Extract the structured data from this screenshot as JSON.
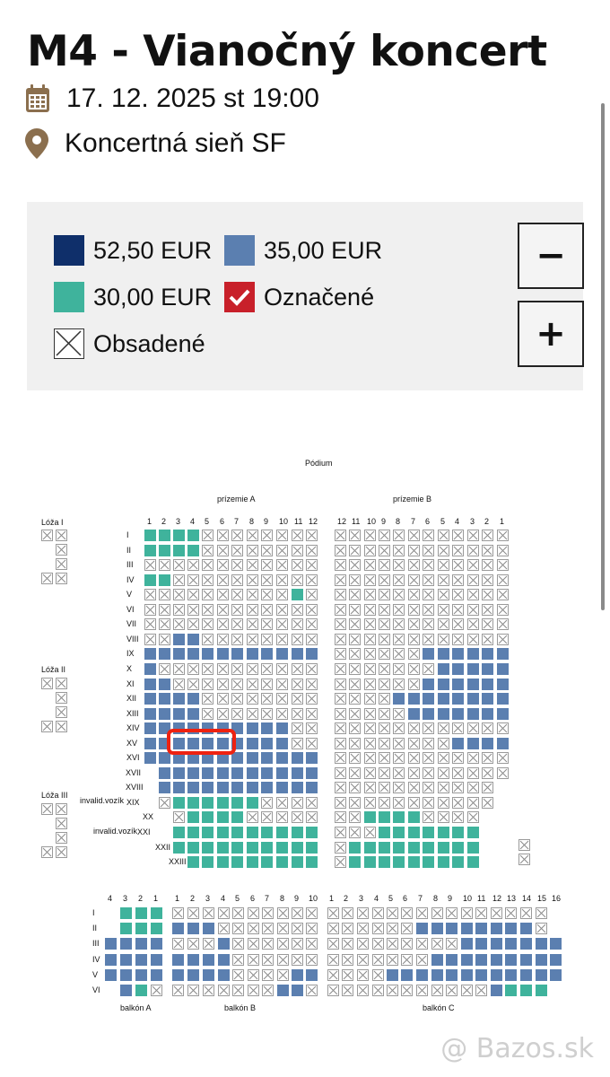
{
  "event": {
    "title": "M4 - Vianočný koncert",
    "datetime": "17. 12. 2025 st 19:00",
    "venue": "Koncertná sieň SF"
  },
  "icons": {
    "date": "calendar-icon",
    "venue": "map-pin-icon",
    "selected": "checkmark-icon",
    "taken": "cross-icon"
  },
  "colors": {
    "accent": "#8b6f4e",
    "price_52": "#0f2f6a",
    "price_35": "#5b7fb0",
    "price_30": "#3fb39c",
    "selected": "#c8202a",
    "highlight": "#ee2211"
  },
  "legend": {
    "items": [
      "52,50 EUR",
      "35,00 EUR",
      "30,00 EUR",
      "Označené",
      "Obsadené"
    ],
    "zoom_out": "−",
    "zoom_in": "+"
  },
  "seatmap": {
    "stage": "Pódium",
    "section_a": "prízemie A",
    "section_b": "prízemie B",
    "loza": [
      "Lóža I",
      "Lóža II",
      "Lóža III"
    ],
    "cols_a": [
      "1",
      "2",
      "3",
      "4",
      "5",
      "6",
      "7",
      "8",
      "9",
      "10",
      "11",
      "12"
    ],
    "cols_b": [
      "12",
      "11",
      "10",
      "9",
      "8",
      "7",
      "6",
      "5",
      "4",
      "3",
      "2",
      "1"
    ],
    "rows": [
      "I",
      "II",
      "III",
      "IV",
      "V",
      "VI",
      "VII",
      "VIII",
      "IX",
      "X",
      "XI",
      "XII",
      "XIII",
      "XIV",
      "XV",
      "XVI",
      "XVII",
      "XVIII",
      "XIX",
      "XX",
      "XXI",
      "XXII",
      "XXIII"
    ],
    "invalid_label": "invalid.vozík",
    "balkon_a": "balkón A",
    "balkon_b": "balkón B",
    "balkon_c": "balkón C",
    "balk_cols_a": [
      "4",
      "3",
      "2",
      "1"
    ],
    "balk_cols_b": [
      "1",
      "2",
      "3",
      "4",
      "5",
      "6",
      "7",
      "8",
      "9",
      "10"
    ],
    "balk_cols_c": [
      "1",
      "2",
      "3",
      "4",
      "5",
      "6",
      "7",
      "8",
      "9",
      "10",
      "11",
      "12",
      "13",
      "14",
      "15",
      "16"
    ],
    "balk_rows": [
      "I",
      "II",
      "III",
      "IV",
      "V",
      "VI"
    ]
  },
  "watermark": "@ Bazos.sk"
}
